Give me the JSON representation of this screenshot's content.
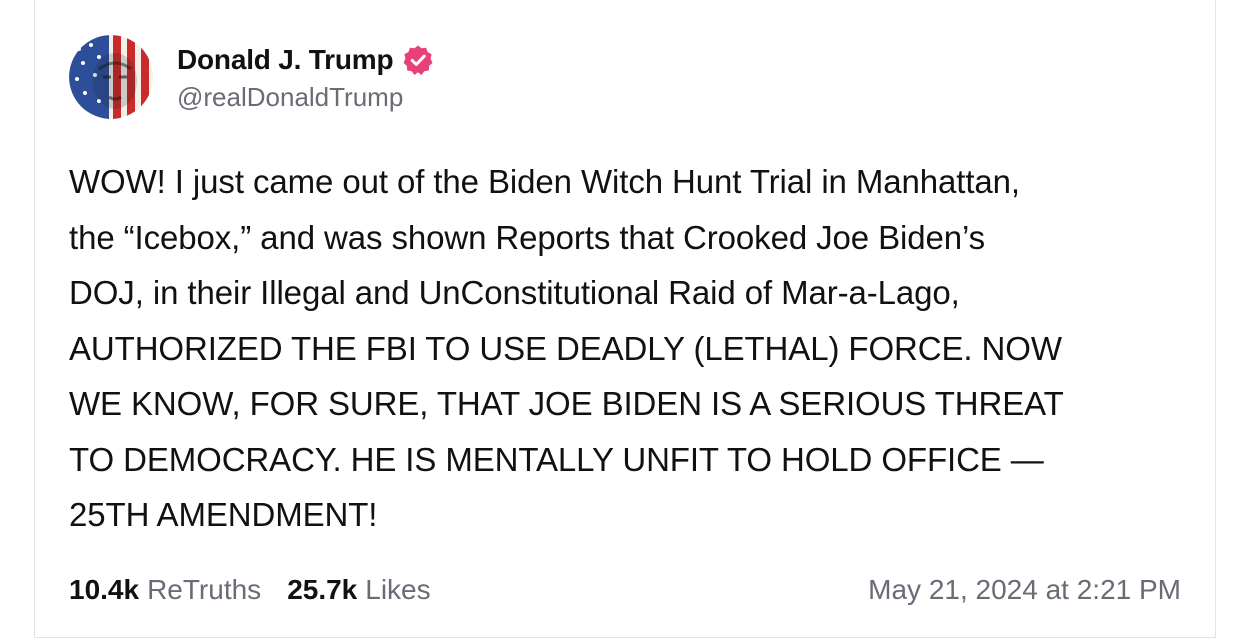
{
  "author": {
    "display_name": "Donald J. Trump",
    "handle": "@realDonaldTrump",
    "verified_icon": "verified-badge-icon",
    "verified_color": "#e8407a"
  },
  "post": {
    "text": "WOW! I just came out of the Biden Witch Hunt Trial in Manhattan,\nthe “Icebox,” and was shown Reports that Crooked Joe Biden’s\nDOJ, in their Illegal and UnConstitutional Raid of Mar-a-Lago,\nAUTHORIZED THE FBI TO USE DEADLY (LETHAL) FORCE. NOW\nWE KNOW, FOR SURE, THAT JOE BIDEN IS A SERIOUS THREAT\nTO DEMOCRACY. HE IS MENTALLY UNFIT TO HOLD OFFICE —\n25TH AMENDMENT!"
  },
  "stats": {
    "retruths_count": "10.4k",
    "retruths_label": "ReTruths",
    "likes_count": "25.7k",
    "likes_label": "Likes"
  },
  "timestamp": "May 21, 2024 at 2:21 PM",
  "colors": {
    "text": "#111111",
    "muted": "#6b6b76",
    "border": "#e3e3e3"
  }
}
